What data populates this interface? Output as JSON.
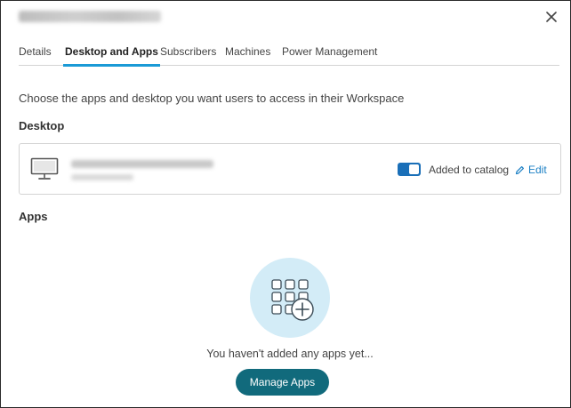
{
  "header": {
    "close_icon": "close-icon"
  },
  "tabs": [
    {
      "label": "Details",
      "active": false
    },
    {
      "label": "Desktop and Apps",
      "active": true
    },
    {
      "label": "Subscribers",
      "active": false
    },
    {
      "label": "Machines",
      "active": false
    },
    {
      "label": "Power Management",
      "active": false
    }
  ],
  "intro": "Choose the apps and desktop you want users to access in their Workspace",
  "desktop": {
    "section_title": "Desktop",
    "icon": "monitor-icon",
    "toggle_on": true,
    "toggle_label": "Added to catalog",
    "edit_label": "Edit",
    "edit_icon": "pencil-icon"
  },
  "apps": {
    "section_title": "Apps",
    "empty_icon": "apps-grid-add-icon",
    "empty_text": "You haven't added any apps yet...",
    "manage_label": "Manage Apps"
  },
  "colors": {
    "accent": "#1a9ad6",
    "toggle": "#1a6fb8",
    "link": "#1a7fc4",
    "primary_button": "#116a7c",
    "empty_circle": "#d3ecf7"
  }
}
